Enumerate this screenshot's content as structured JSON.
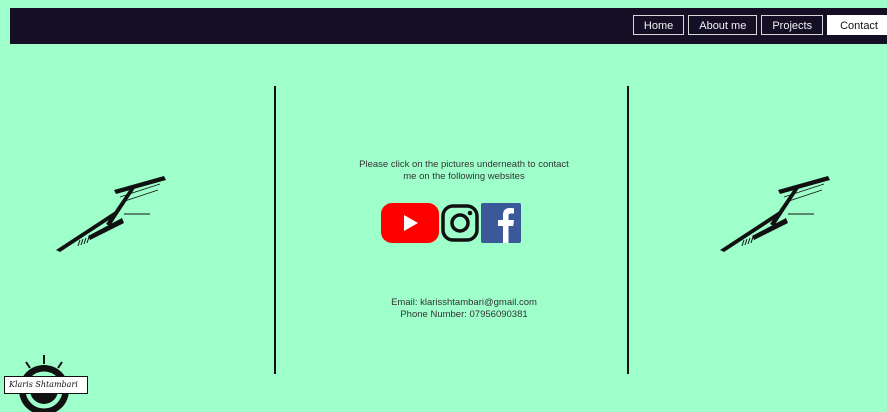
{
  "nav": {
    "items": [
      {
        "label": "Home"
      },
      {
        "label": "About me"
      },
      {
        "label": "Projects"
      },
      {
        "label": "Contact"
      }
    ],
    "active": "Contact"
  },
  "main": {
    "intro_line1": "Please click on the pictures underneath to contact",
    "intro_line2": "me on the following websites",
    "email": "Email: klarisshtambari@gmail.com",
    "phone": "Phone Number: 07956090381"
  },
  "socials": [
    "youtube-icon",
    "instagram-icon",
    "facebook-icon"
  ],
  "logo": {
    "text": "Klaris Shtambari"
  },
  "colors": {
    "background": "#9fffcb",
    "header": "#140f24",
    "youtube": "#ff0000",
    "facebook": "#3b5998"
  }
}
